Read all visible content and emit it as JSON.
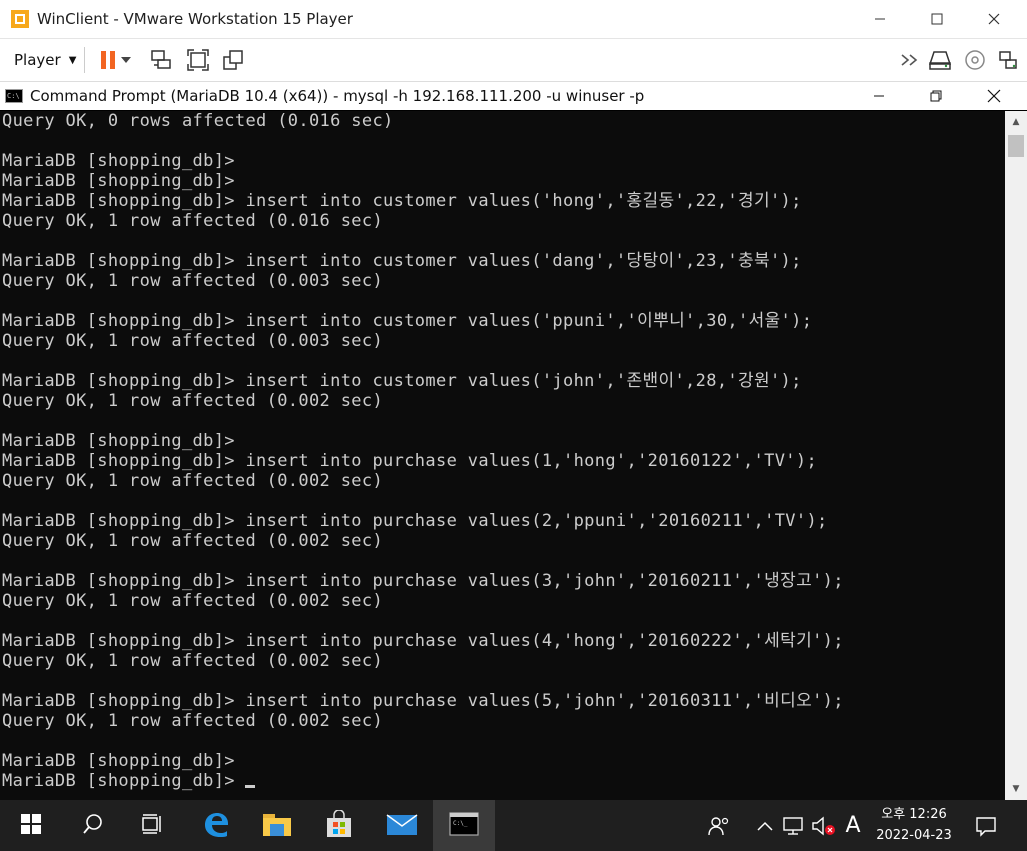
{
  "vm_window": {
    "title": "WinClient - VMware Workstation 15 Player",
    "player_menu_label": "Player"
  },
  "cmd_window": {
    "title": "Command Prompt (MariaDB 10.4 (x64)) - mysql  -h 192.168.111.200 -u winuser -p"
  },
  "console": {
    "lines": [
      "Query OK, 0 rows affected (0.016 sec)",
      "",
      "MariaDB [shopping_db]>",
      "MariaDB [shopping_db]>",
      "MariaDB [shopping_db]> insert into customer values('hong','홍길동',22,'경기');",
      "Query OK, 1 row affected (0.016 sec)",
      "",
      "MariaDB [shopping_db]> insert into customer values('dang','당탕이',23,'충북');",
      "Query OK, 1 row affected (0.003 sec)",
      "",
      "MariaDB [shopping_db]> insert into customer values('ppuni','이뿌니',30,'서울');",
      "Query OK, 1 row affected (0.003 sec)",
      "",
      "MariaDB [shopping_db]> insert into customer values('john','존밴이',28,'강원');",
      "Query OK, 1 row affected (0.002 sec)",
      "",
      "MariaDB [shopping_db]>",
      "MariaDB [shopping_db]> insert into purchase values(1,'hong','20160122','TV');",
      "Query OK, 1 row affected (0.002 sec)",
      "",
      "MariaDB [shopping_db]> insert into purchase values(2,'ppuni','20160211','TV');",
      "Query OK, 1 row affected (0.002 sec)",
      "",
      "MariaDB [shopping_db]> insert into purchase values(3,'john','20160211','냉장고');",
      "Query OK, 1 row affected (0.002 sec)",
      "",
      "MariaDB [shopping_db]> insert into purchase values(4,'hong','20160222','세탁기');",
      "Query OK, 1 row affected (0.002 sec)",
      "",
      "MariaDB [shopping_db]> insert into purchase values(5,'john','20160311','비디오');",
      "Query OK, 1 row affected (0.002 sec)",
      "",
      "MariaDB [shopping_db]>"
    ],
    "prompt": "MariaDB [shopping_db]> "
  },
  "taskbar": {
    "clock_time": "오후 12:26",
    "clock_date": "2022-04-23",
    "ime_indicator": "A"
  },
  "colors": {
    "console_bg": "#0c0c0c",
    "console_text": "#cccccc",
    "taskbar_bg": "#1f1f1f",
    "vmware_pause_orange": "#f26522",
    "edge_blue": "#1e90e0",
    "mail_blue": "#2b88d8",
    "explorer_yellow": "#f8c948"
  }
}
